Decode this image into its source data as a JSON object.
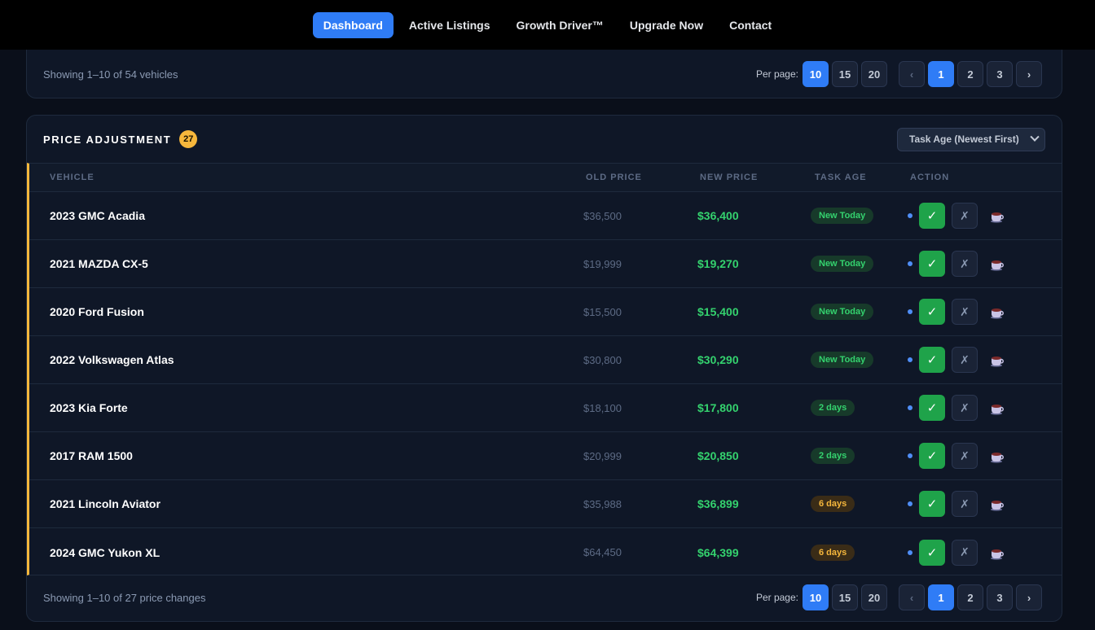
{
  "nav": {
    "items": [
      "Dashboard",
      "Active Listings",
      "Growth Driver™",
      "Upgrade Now",
      "Contact"
    ]
  },
  "top_card": {
    "showing": "Showing 1–10 of 54 vehicles",
    "per_page_label": "Per page:",
    "per_page": [
      "10",
      "15",
      "20"
    ],
    "prev": "‹",
    "pages": [
      "1",
      "2",
      "3"
    ],
    "next": "›"
  },
  "price_adjustment": {
    "title": "PRICE ADJUSTMENT",
    "count": "27",
    "sort_value": "Task Age (Newest First)",
    "columns": {
      "vehicle": "VEHICLE",
      "old_price": "OLD PRICE",
      "new_price": "NEW PRICE",
      "task_age": "TASK AGE",
      "action": "ACTION"
    },
    "rows": [
      {
        "vehicle": "2023 GMC Acadia",
        "old_price": "$36,500",
        "new_price": "$36,400",
        "age": "New Today"
      },
      {
        "vehicle": "2021 MAZDA CX-5",
        "old_price": "$19,999",
        "new_price": "$19,270",
        "age": "New Today"
      },
      {
        "vehicle": "2020 Ford Fusion",
        "old_price": "$15,500",
        "new_price": "$15,400",
        "age": "New Today"
      },
      {
        "vehicle": "2022 Volkswagen Atlas",
        "old_price": "$30,800",
        "new_price": "$30,290",
        "age": "New Today"
      },
      {
        "vehicle": "2023 Kia Forte",
        "old_price": "$18,100",
        "new_price": "$17,800",
        "age": "2 days"
      },
      {
        "vehicle": "2017 RAM 1500",
        "old_price": "$20,999",
        "new_price": "$20,850",
        "age": "2 days"
      },
      {
        "vehicle": "2021 Lincoln Aviator",
        "old_price": "$35,988",
        "new_price": "$36,899",
        "age": "6 days"
      },
      {
        "vehicle": "2024 GMC Yukon XL",
        "old_price": "$64,450",
        "new_price": "$64,399",
        "age": "6 days"
      }
    ],
    "approve_icon": "✓",
    "reject_icon": "✗",
    "footer": {
      "showing": "Showing 1–10 of 27 price changes",
      "per_page_label": "Per page:",
      "per_page": [
        "10",
        "15",
        "20"
      ],
      "prev": "‹",
      "pages": [
        "1",
        "2",
        "3"
      ],
      "next": "›"
    }
  },
  "colors": {
    "accent": "#2f7cf6",
    "approve": "#1fa34a",
    "price_green": "#34d26e",
    "warning": "#f6b73c"
  }
}
